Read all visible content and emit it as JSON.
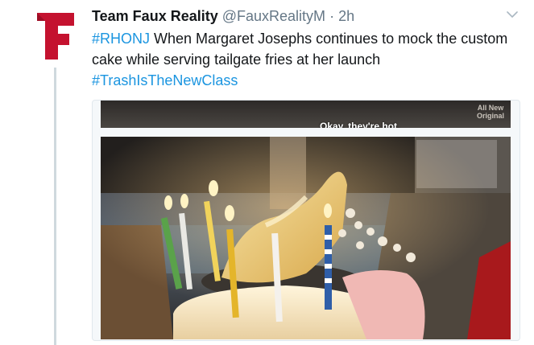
{
  "tweet": {
    "author_name": "Team Faux Reality",
    "handle": "@FauxRealityM",
    "separator": "·",
    "time": "2h",
    "text_hashtag_1": "#RHONJ",
    "text_body": " When Margaret Josephs continues to mock the custom cake while serving tailgate fries at her launch",
    "text_hashtag_2": "#TrashIsTheNewClass",
    "avatar_letter": "F"
  },
  "media": {
    "watermark_line1": "All New",
    "watermark_line2": "Original",
    "caption": "Okay, they're hot."
  },
  "icons": {
    "avatar": "f-logo-icon",
    "menu": "chevron-down-icon"
  },
  "colors": {
    "accent": "#1b95e0",
    "avatar_red": "#c4122f"
  }
}
